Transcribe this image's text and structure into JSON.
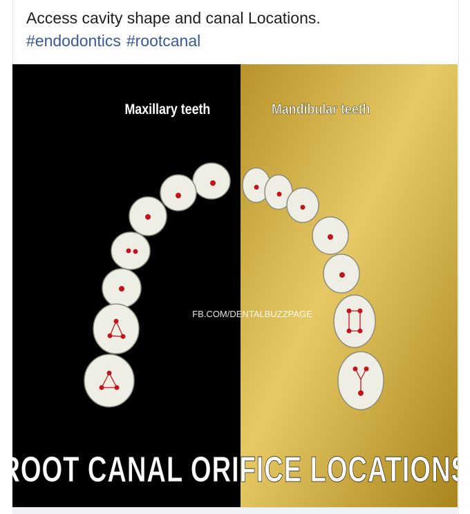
{
  "post": {
    "caption": "Access cavity shape and canal Locations.",
    "hashtags": [
      "#endodontics",
      "#rootcanal"
    ]
  },
  "image": {
    "left_title": "Maxillary teeth",
    "right_title": "Mandibular teeth",
    "watermark": "FB.COM/DENTALBUZZPAGE",
    "headline": "ROOT CANAL ORIFICE LOCATIONS"
  },
  "colors": {
    "left_bg": "#000000",
    "gold_light": "#e2c35a",
    "gold_dark": "#a9851c",
    "orifice": "#c0151f",
    "tooth": "#efeee4"
  }
}
